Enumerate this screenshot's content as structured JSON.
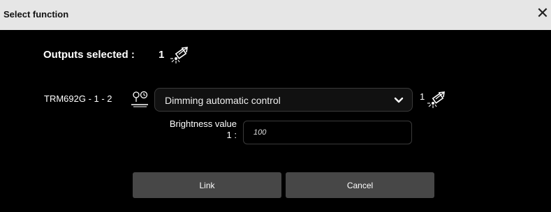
{
  "dialog": {
    "title": "Select function",
    "close_glyph": "✕"
  },
  "outputs": {
    "label": "Outputs selected :",
    "count": "1",
    "icon": "light-output-icon"
  },
  "row": {
    "device_label": "TRM692G - 1 - 2",
    "device_icon": "sensor-icon",
    "function_select": {
      "selected": "Dimming automatic control",
      "icon": "chevron-down-icon"
    },
    "output_count": "1",
    "output_icon": "light-output-icon"
  },
  "brightness": {
    "label_line1": "Brightness value",
    "label_line2": "1 :",
    "value": "100"
  },
  "buttons": {
    "link_label": "Link",
    "cancel_label": "Cancel"
  }
}
